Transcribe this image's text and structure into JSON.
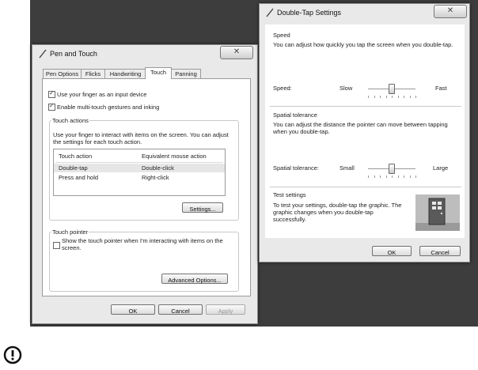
{
  "pen_touch": {
    "title": "Pen and Touch",
    "tabs": [
      "Pen Options",
      "Flicks",
      "Handwriting",
      "Touch",
      "Panning"
    ],
    "use_finger": "Use your finger as an input device",
    "multi_touch": "Enable multi-touch gestures and inking",
    "touch_actions": {
      "title": "Touch actions",
      "description": "Use your finger to interact with items on the screen. You can adjust the settings for each touch action.",
      "headers": [
        "Touch action",
        "Equivalent mouse action"
      ],
      "rows": [
        {
          "action": "Double-tap",
          "mouse": "Double-click"
        },
        {
          "action": "Press and hold",
          "mouse": "Right-click"
        }
      ],
      "settings_button": "Settings..."
    },
    "touch_pointer": {
      "title": "Touch pointer",
      "show_pointer": "Show the touch pointer when I'm interacting with items on the screen.",
      "advanced_button": "Advanced Options..."
    },
    "ok": "OK",
    "cancel": "Cancel",
    "apply": "Apply"
  },
  "double_tap": {
    "title": "Double-Tap Settings",
    "speed": {
      "title": "Speed",
      "description": "You can adjust how quickly you tap the screen when you double-tap.",
      "label": "Speed:",
      "min": "Slow",
      "max": "Fast",
      "value_fraction": 0.5
    },
    "tolerance": {
      "title": "Spatial tolerance",
      "description": "You can adjust the distance the pointer can move between tapping when you double-tap.",
      "label": "Spatial tolerance:",
      "min": "Small",
      "max": "Large",
      "value_fraction": 0.5
    },
    "test": {
      "title": "Test settings",
      "description": "To test your settings, double-tap the graphic. The graphic changes when you double-tap successfully."
    },
    "ok": "OK",
    "cancel": "Cancel"
  }
}
